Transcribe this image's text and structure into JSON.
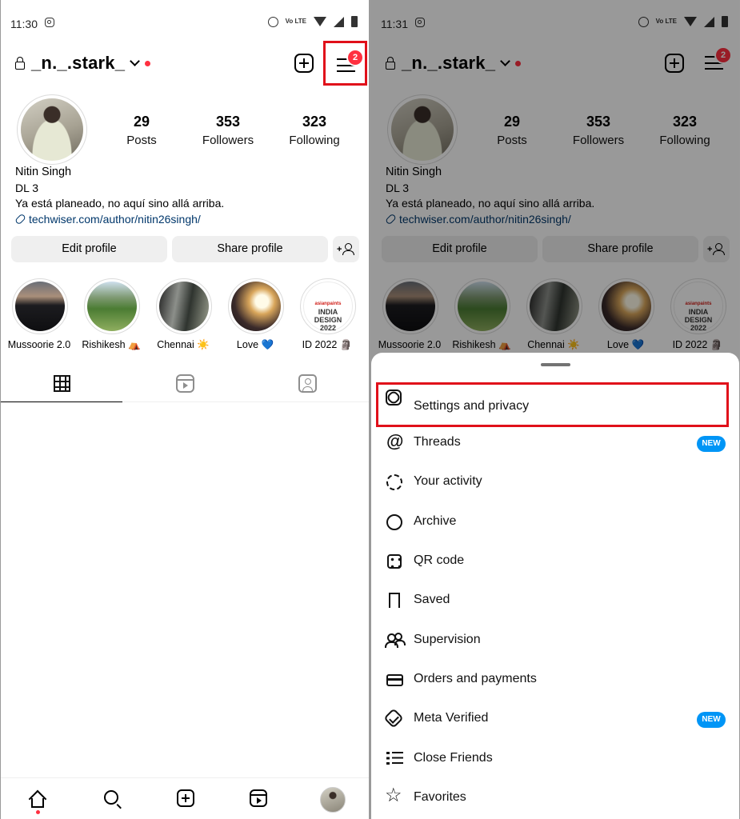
{
  "left": {
    "status": {
      "time": "11:30",
      "volte": "Vo LTE"
    },
    "header": {
      "username": "_n._.stark_",
      "menu_badge": "2"
    },
    "stats": [
      {
        "value": "29",
        "label": "Posts"
      },
      {
        "value": "353",
        "label": "Followers"
      },
      {
        "value": "323",
        "label": "Following"
      }
    ],
    "bio": {
      "name": "Nitin Singh",
      "line2": "DL 3",
      "line3": "Ya está planeado, no aquí sino allá arriba.",
      "link": "techwiser.com/author/nitin26singh/"
    },
    "buttons": {
      "edit": "Edit profile",
      "share": "Share profile"
    },
    "highlights": [
      "Mussoorie 2.0",
      "Rishikesh ⛺",
      "Chennai ☀️",
      "Love 💙",
      "ID 2022 🗿"
    ],
    "id_highlight_text": {
      "brand": "asianpaints",
      "line1": "INDIA",
      "line2": "DESIGN",
      "line3": "2022"
    }
  },
  "right": {
    "status": {
      "time": "11:31",
      "volte": "Vo LTE"
    },
    "header": {
      "username": "_n._.stark_",
      "menu_badge": "2"
    },
    "stats": [
      {
        "value": "29",
        "label": "Posts"
      },
      {
        "value": "353",
        "label": "Followers"
      },
      {
        "value": "323",
        "label": "Following"
      }
    ],
    "bio": {
      "name": "Nitin Singh",
      "line2": "DL 3",
      "line3": "Ya está planeado, no aquí sino allá arriba.",
      "link": "techwiser.com/author/nitin26singh/"
    },
    "buttons": {
      "edit": "Edit profile",
      "share": "Share profile"
    },
    "highlights": [
      "Mussoorie 2.0",
      "Rishikesh ⛺",
      "Chennai ☀️",
      "Love 💙",
      "ID 2022 🗿"
    ],
    "sheet": {
      "items": [
        {
          "label": "Settings and privacy",
          "icon": "settings-icon"
        },
        {
          "label": "Threads",
          "icon": "threads-icon",
          "badge": "NEW"
        },
        {
          "label": "Your activity",
          "icon": "activity-icon"
        },
        {
          "label": "Archive",
          "icon": "archive-icon"
        },
        {
          "label": "QR code",
          "icon": "qr-code-icon"
        },
        {
          "label": "Saved",
          "icon": "bookmark-icon"
        },
        {
          "label": "Supervision",
          "icon": "supervision-icon"
        },
        {
          "label": "Orders and payments",
          "icon": "card-icon"
        },
        {
          "label": "Meta Verified",
          "icon": "verified-icon",
          "badge": "NEW"
        },
        {
          "label": "Close Friends",
          "icon": "close-friends-icon"
        },
        {
          "label": "Favorites",
          "icon": "star-icon"
        }
      ]
    }
  },
  "colors": {
    "highlight_box": "#e0101a",
    "badge_red": "#ff3040",
    "new_badge": "#0095f6",
    "link": "#00376b"
  }
}
